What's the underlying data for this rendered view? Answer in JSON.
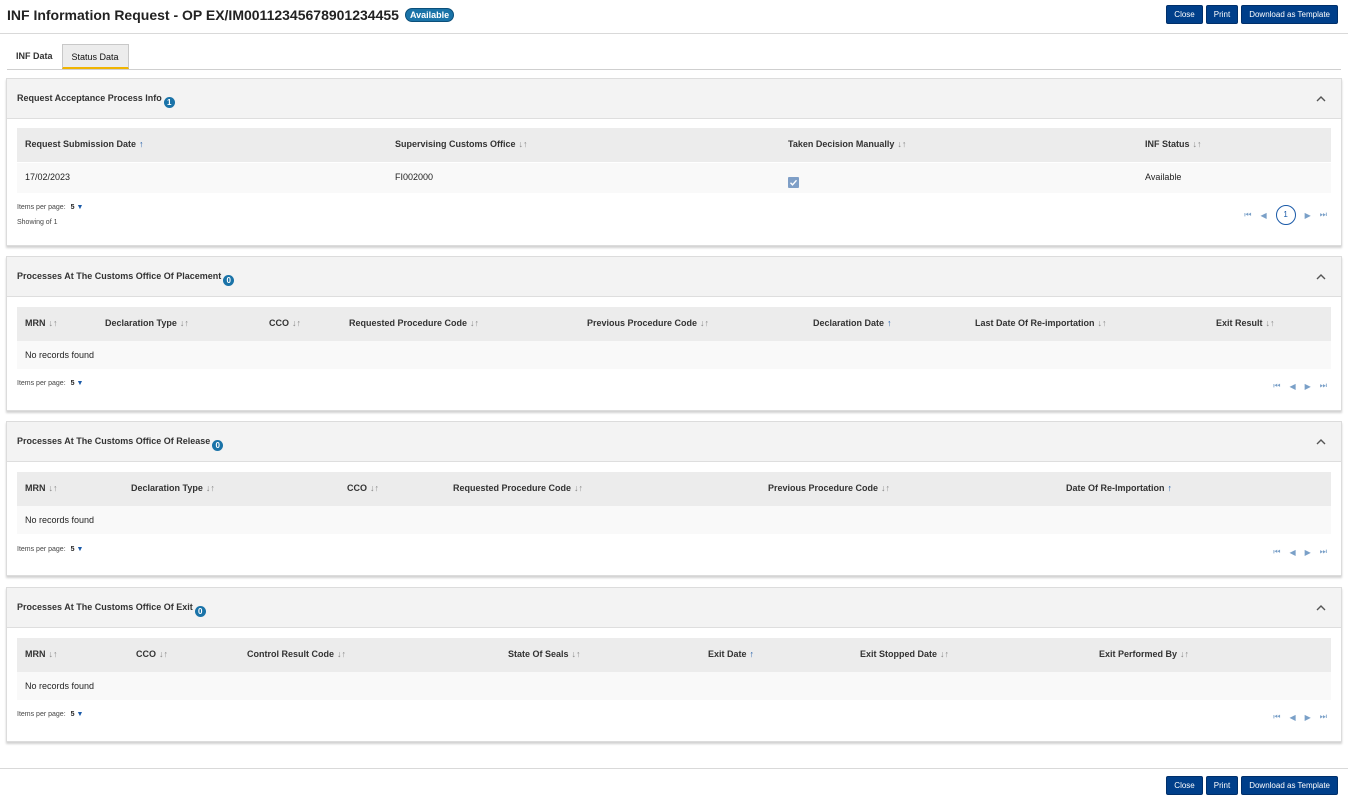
{
  "header": {
    "title": "INF Information Request - OP EX/IM00112345678901234455",
    "status_badge": "Available",
    "buttons": {
      "close": "Close",
      "print": "Print",
      "download": "Download as Template"
    }
  },
  "tabs": [
    {
      "label": "INF Data",
      "active": false
    },
    {
      "label": "Status Data",
      "active": true
    }
  ],
  "sections": {
    "acceptance": {
      "title": "Request Acceptance Process Info",
      "count": "1",
      "columns": [
        "Request Submission Date",
        "Supervising Customs Office",
        "Taken Decision Manually",
        "INF Status"
      ],
      "rows": [
        {
          "submission_date": "17/02/2023",
          "office": "FI002000",
          "taken_manually": true,
          "status": "Available"
        }
      ],
      "items_per_page_label": "Items per page:",
      "items_per_page": "5",
      "showing": "Showing of 1",
      "current_page": "1"
    },
    "placement": {
      "title": "Processes At The Customs Office Of Placement",
      "count": "0",
      "columns": [
        "MRN",
        "Declaration Type",
        "CCO",
        "Requested Procedure Code",
        "Previous Procedure Code",
        "Declaration Date",
        "Last Date Of Re-importation",
        "Exit Result"
      ],
      "empty": "No records found",
      "items_per_page_label": "Items per page:",
      "items_per_page": "5"
    },
    "release": {
      "title": "Processes At The Customs Office Of Release",
      "count": "0",
      "columns": [
        "MRN",
        "Declaration Type",
        "CCO",
        "Requested Procedure Code",
        "Previous Procedure Code",
        "Date Of Re-Importation"
      ],
      "empty": "No records found",
      "items_per_page_label": "Items per page:",
      "items_per_page": "5"
    },
    "exit": {
      "title": "Processes At The Customs Office Of Exit",
      "count": "0",
      "columns": [
        "MRN",
        "CCO",
        "Control Result Code",
        "State Of Seals",
        "Exit Date",
        "Exit Stopped Date",
        "Exit Performed By"
      ],
      "empty": "No records found",
      "items_per_page_label": "Items per page:",
      "items_per_page": "5"
    }
  },
  "colors": {
    "primary_button": "#003f8a",
    "badge": "#1a73a8",
    "active_tab_underline": "#f0b400"
  }
}
